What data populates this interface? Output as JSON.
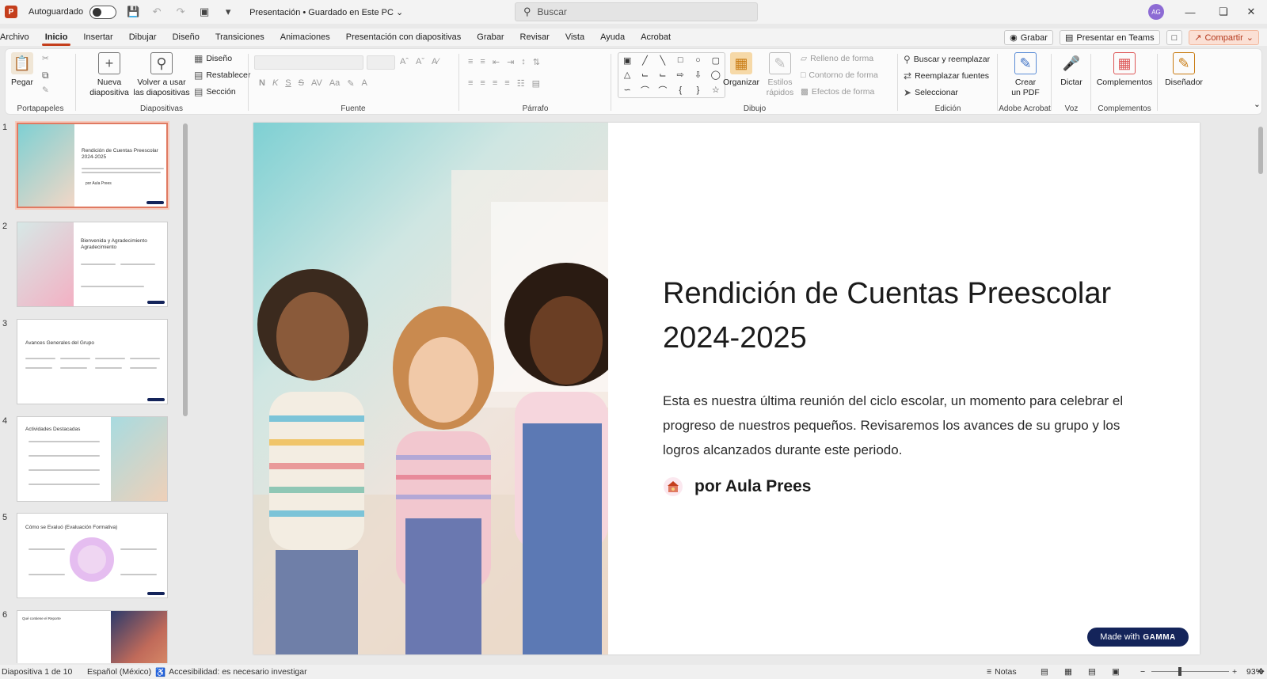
{
  "titlebar": {
    "autosave_label": "Autoguardado",
    "document_title": "Presentación • Guardado en Este PC",
    "search_placeholder": "Buscar",
    "avatar_initials": "AG"
  },
  "menu": {
    "tabs": [
      "Archivo",
      "Inicio",
      "Insertar",
      "Dibujar",
      "Diseño",
      "Transiciones",
      "Animaciones",
      "Presentación con diapositivas",
      "Grabar",
      "Revisar",
      "Vista",
      "Ayuda",
      "Acrobat"
    ],
    "active_tab": "Inicio",
    "record_label": "Grabar",
    "teams_label": "Presentar en Teams",
    "share_label": "Compartir"
  },
  "ribbon": {
    "portapapeles": {
      "paste": "Pegar",
      "label": "Portapapeles"
    },
    "diapositivas": {
      "new_line1": "Nueva",
      "new_line2": "diapositiva",
      "reuse_line1": "Volver a usar",
      "reuse_line2": "las diapositivas",
      "layout": "Diseño",
      "reset": "Restablecer",
      "section": "Sección",
      "label": "Diapositivas"
    },
    "fuente": {
      "label": "Fuente"
    },
    "parrafo": {
      "label": "Párrafo"
    },
    "dibujo": {
      "arrange": "Organizar",
      "quick_styles_line1": "Estilos",
      "quick_styles_line2": "rápidos",
      "fill": "Relleno de forma",
      "outline": "Contorno de forma",
      "effects": "Efectos de forma",
      "label": "Dibujo"
    },
    "edicion": {
      "find_replace": "Buscar y reemplazar",
      "replace_fonts": "Reemplazar fuentes",
      "select": "Seleccionar",
      "label": "Edición"
    },
    "acrobat": {
      "create_line1": "Crear",
      "create_line2": "un PDF",
      "label": "Adobe Acrobat"
    },
    "voz": {
      "dictate": "Dictar",
      "label": "Voz"
    },
    "complementos": {
      "addins": "Complementos",
      "label": "Complementos"
    },
    "designer": {
      "label": "Diseñador"
    }
  },
  "thumbnails": [
    {
      "number": "1",
      "title_line1": "Rendición de Cuentas Preescolar",
      "title_line2": "2024-2025",
      "author": "por Aula Prees"
    },
    {
      "number": "2",
      "title_line1": "Bienvenida y Agradecimiento",
      "title_line2": "Agradecimiento"
    },
    {
      "number": "3",
      "title_line1": "Avances Generales del Grupo",
      "title_line2": ""
    },
    {
      "number": "4",
      "title_line1": "Actividades Destacadas",
      "title_line2": ""
    },
    {
      "number": "5",
      "title_line1": "Cómo se Evaluó (Evaluación Formativa)",
      "title_line2": ""
    },
    {
      "number": "6",
      "title_line1": "Qué contiene el Reporte",
      "title_line2": ""
    }
  ],
  "slide": {
    "title_line1": "Rendición de Cuentas Preescolar",
    "title_line2": "2024-2025",
    "body": "Esta es nuestra última reunión del ciclo escolar, un momento para celebrar el progreso de nuestros pequeños. Revisaremos los avances de su grupo y los logros alcanzados durante este periodo.",
    "author": "por Aula Prees",
    "badge_prefix": "Made with",
    "badge_brand": "GAMMA"
  },
  "statusbar": {
    "slide_counter": "Diapositiva 1 de 10",
    "language": "Español (México)",
    "accessibility": "Accesibilidad: es necesario investigar",
    "notes": "Notas",
    "zoom": "93%",
    "zoom_level": 0.37
  },
  "colors": {
    "accent": "#c43e1c",
    "badge": "#14245a"
  }
}
